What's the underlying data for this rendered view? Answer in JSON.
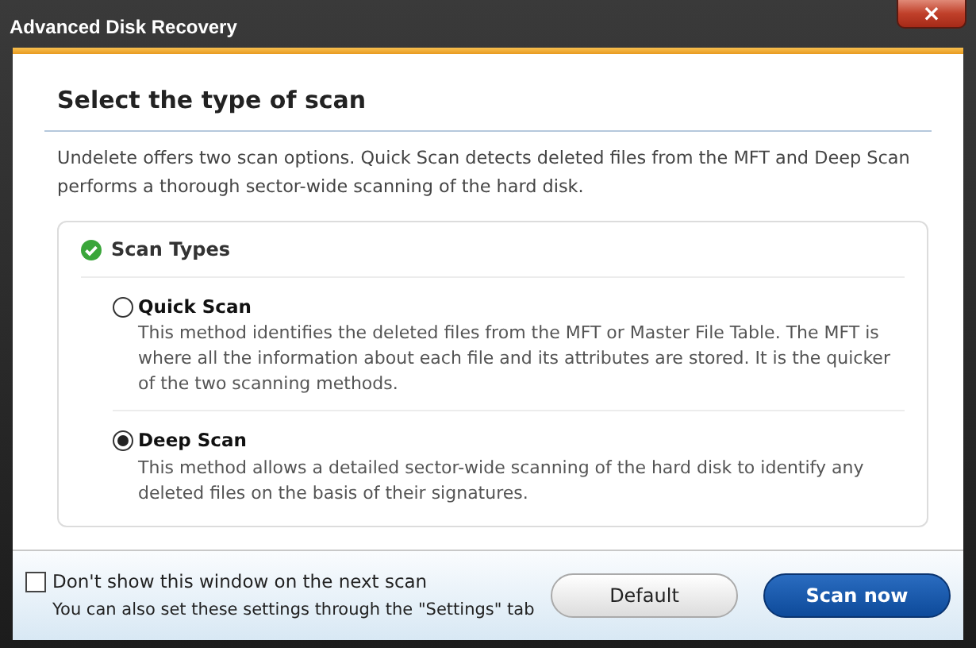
{
  "window": {
    "title": "Advanced Disk Recovery",
    "close": "×"
  },
  "heading": "Select the type of scan",
  "intro": "Undelete offers two scan options. Quick Scan detects deleted files from the MFT and Deep Scan performs a thorough sector-wide scanning of the hard disk.",
  "group": {
    "title": "Scan Types",
    "options": [
      {
        "label": "Quick Scan",
        "selected": false,
        "description": "This method identifies the deleted files from the MFT or Master File Table. The MFT is where all the information about each file and its attributes are stored. It is the quicker of the two scanning methods."
      },
      {
        "label": "Deep Scan",
        "selected": true,
        "description": "This method allows a detailed sector-wide scanning of the hard disk to identify any deleted files on the basis of their signatures."
      }
    ]
  },
  "footer": {
    "checkbox": {
      "label": "Don't show this window on the next scan",
      "checked": false
    },
    "hint": "You can also set these settings through the \"Settings\" tab",
    "buttons": [
      {
        "label": "Default",
        "kind": "secondary"
      },
      {
        "label": "Scan now",
        "kind": "primary"
      }
    ]
  }
}
